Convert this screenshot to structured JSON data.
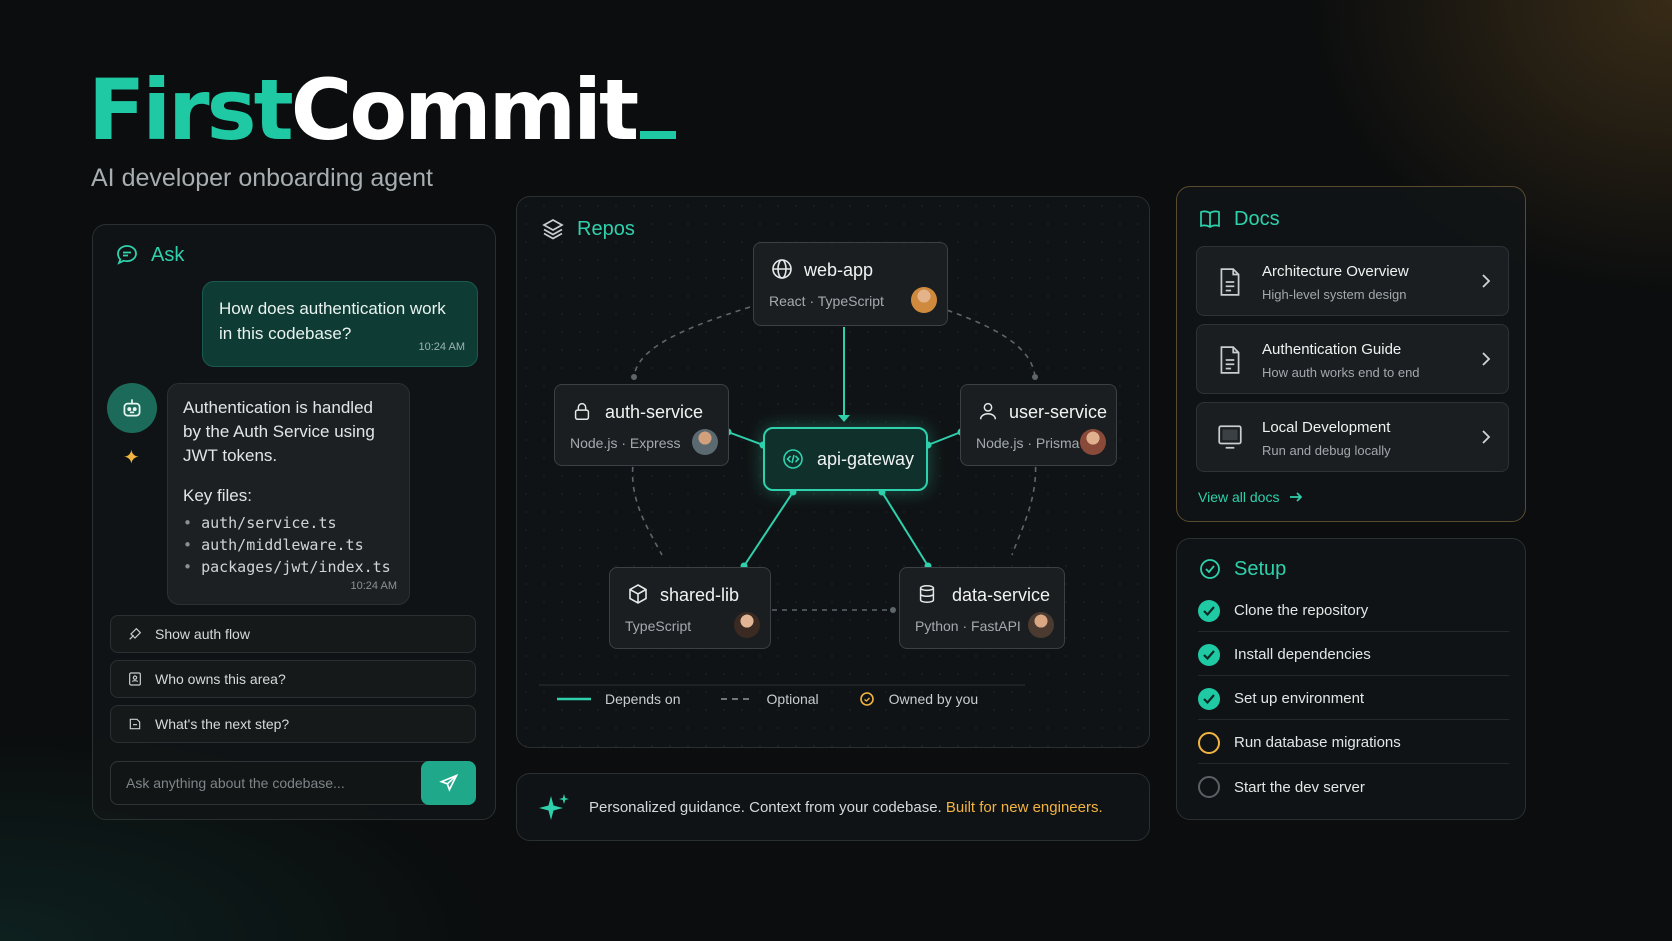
{
  "brand": {
    "first": "First",
    "commit": "Commit",
    "tagline": "AI developer onboarding agent"
  },
  "colors": {
    "accent": "#1fc9a4",
    "warning": "#f2b441",
    "background": "#0b0d0e"
  },
  "ask": {
    "title": "Ask",
    "user_message": "How does authentication work in this codebase?",
    "user_time": "10:24 AM",
    "bot_message": "Authentication is handled by the Auth Service using JWT tokens.",
    "key_files_label": "Key files:",
    "key_files": [
      "auth/service.ts",
      "auth/middleware.ts",
      "packages/jwt/index.ts"
    ],
    "bot_time": "10:24 AM",
    "suggestions": [
      {
        "label": "Show auth flow",
        "icon": "flow-icon"
      },
      {
        "label": "Who owns this area?",
        "icon": "owner-icon"
      },
      {
        "label": "What's the next step?",
        "icon": "next-step-icon"
      }
    ],
    "input_placeholder": "Ask anything about the codebase...",
    "send_icon": "send-icon"
  },
  "repos": {
    "title": "Repos",
    "nodes": {
      "web_app": {
        "name": "web-app",
        "meta": "React · TypeScript",
        "icon": "globe-icon"
      },
      "auth_service": {
        "name": "auth-service",
        "meta": "Node.js · Express",
        "icon": "lock-icon"
      },
      "user_service": {
        "name": "user-service",
        "meta": "Node.js · Prisma",
        "icon": "user-icon"
      },
      "api_gateway": {
        "name": "api-gateway",
        "icon": "code-icon"
      },
      "shared_lib": {
        "name": "shared-lib",
        "meta": "TypeScript",
        "icon": "package-icon"
      },
      "data_service": {
        "name": "data-service",
        "meta": "Python · FastAPI",
        "icon": "database-icon"
      }
    },
    "legend": {
      "depends_on": "Depends on",
      "optional": "Optional",
      "owned": "Owned by you"
    }
  },
  "footer": {
    "text": "Personalized guidance. Context from your codebase.",
    "accent": "Built for new engineers."
  },
  "docs": {
    "title": "Docs",
    "items": [
      {
        "title": "Architecture Overview",
        "subtitle": "High-level system design",
        "icon": "document-icon"
      },
      {
        "title": "Authentication Guide",
        "subtitle": "How auth works end to end",
        "icon": "document-icon"
      },
      {
        "title": "Local Development",
        "subtitle": "Run and debug locally",
        "icon": "monitor-icon"
      }
    ],
    "view_all": "View all docs"
  },
  "setup": {
    "title": "Setup",
    "steps": [
      {
        "label": "Clone the repository",
        "status": "done"
      },
      {
        "label": "Install dependencies",
        "status": "done"
      },
      {
        "label": "Set up environment",
        "status": "done"
      },
      {
        "label": "Run database migrations",
        "status": "in-progress"
      },
      {
        "label": "Start the dev server",
        "status": "todo"
      }
    ]
  }
}
